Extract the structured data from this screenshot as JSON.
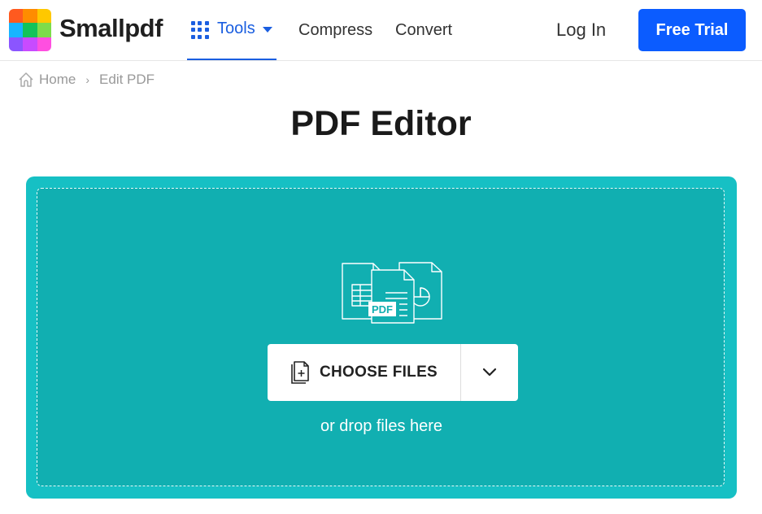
{
  "header": {
    "brand": "Smallpdf",
    "logo_colors": [
      "#ff5a1f",
      "#ff8c00",
      "#ffc800",
      "#18b4ff",
      "#12c35a",
      "#7ddc4a",
      "#8b55ff",
      "#c84bff",
      "#ff4fe0"
    ],
    "nav": {
      "tools_label": "Tools",
      "compress_label": "Compress",
      "convert_label": "Convert"
    },
    "login_label": "Log In",
    "free_trial_label": "Free Trial"
  },
  "breadcrumb": {
    "home": "Home",
    "separator": "›",
    "current": "Edit PDF"
  },
  "page": {
    "title": "PDF Editor"
  },
  "dropzone": {
    "icon_badge": "PDF",
    "choose_files_label": "CHOOSE FILES",
    "drop_hint": "or drop files here"
  },
  "colors": {
    "accent_blue": "#0b5cff",
    "nav_blue": "#1a5ee0",
    "dropzone_outer": "#16c0c4",
    "dropzone_inner": "#11afb1"
  }
}
